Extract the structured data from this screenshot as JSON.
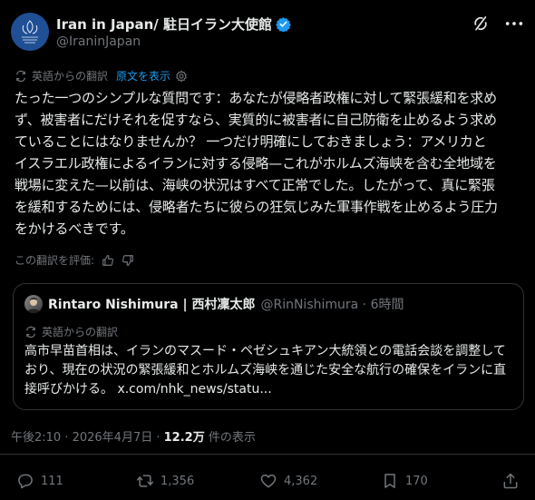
{
  "post": {
    "display_name": "Iran in Japan/ 駐日イラン大使館",
    "handle": "@IraninJapan",
    "avatar_label": "Embassy crest",
    "translation_label": "英語からの翻訳",
    "show_original": "原文を表示",
    "body_lines": [
      "たった一つのシンプルな質問です：あなたが侵略者政権に対して緊張緩和を求め",
      "ず、被害者にだけそれを促すなら、実質的に被害者に自己防衛を止めるよう求め",
      "ていることにはなりませんか？ 一つだけ明確にしておきましょう：アメリカと",
      "イスラエル政権によるイランに対する侵略—これがホルムズ海峡を含む全地域を",
      "戦場に変えた—以前は、海峡の状況はすべて正常でした。したがって、真に緊張",
      "を緩和するためには、侵略者たちに彼らの狂気じみた軍事作戦を止めるよう圧力",
      "をかけるべきです。"
    ],
    "rate_label": "この翻訳を評価:",
    "timestamp": "午後2:10 · 2026年4月7日 ·",
    "views": "12.2万",
    "views_label": "件の表示"
  },
  "quote": {
    "name": "Rintaro Nishimura | 西村凜太郎",
    "handle": "@RinNishimura · 6時間",
    "translation_label": "英語からの翻訳",
    "lines": [
      "高市早苗首相は、イランのマスード・ペゼシュキアン大統領との電話会談を調整して",
      "おり、現在の状況の緊張緩和とホルムズ海峡を通じた安全な航行の確保をイランに直",
      "接呼びかける。 x.com/nhk_news/statu..."
    ]
  },
  "actions": {
    "replies": "111",
    "reposts": "1,356",
    "likes": "4,362",
    "bookmarks": "170"
  },
  "icons": [
    "grok-icon",
    "more-icon",
    "verified-icon",
    "translate-icon",
    "settings-icon",
    "thumbs-up-icon",
    "thumbs-down-icon",
    "reply-icon",
    "repost-icon",
    "like-icon",
    "bookmark-icon",
    "share-icon"
  ],
  "colors": {
    "background": "#000000",
    "text": "#e7e9ea",
    "muted": "#71767b",
    "accent": "#1d9bf0",
    "border": "#2f3336"
  }
}
